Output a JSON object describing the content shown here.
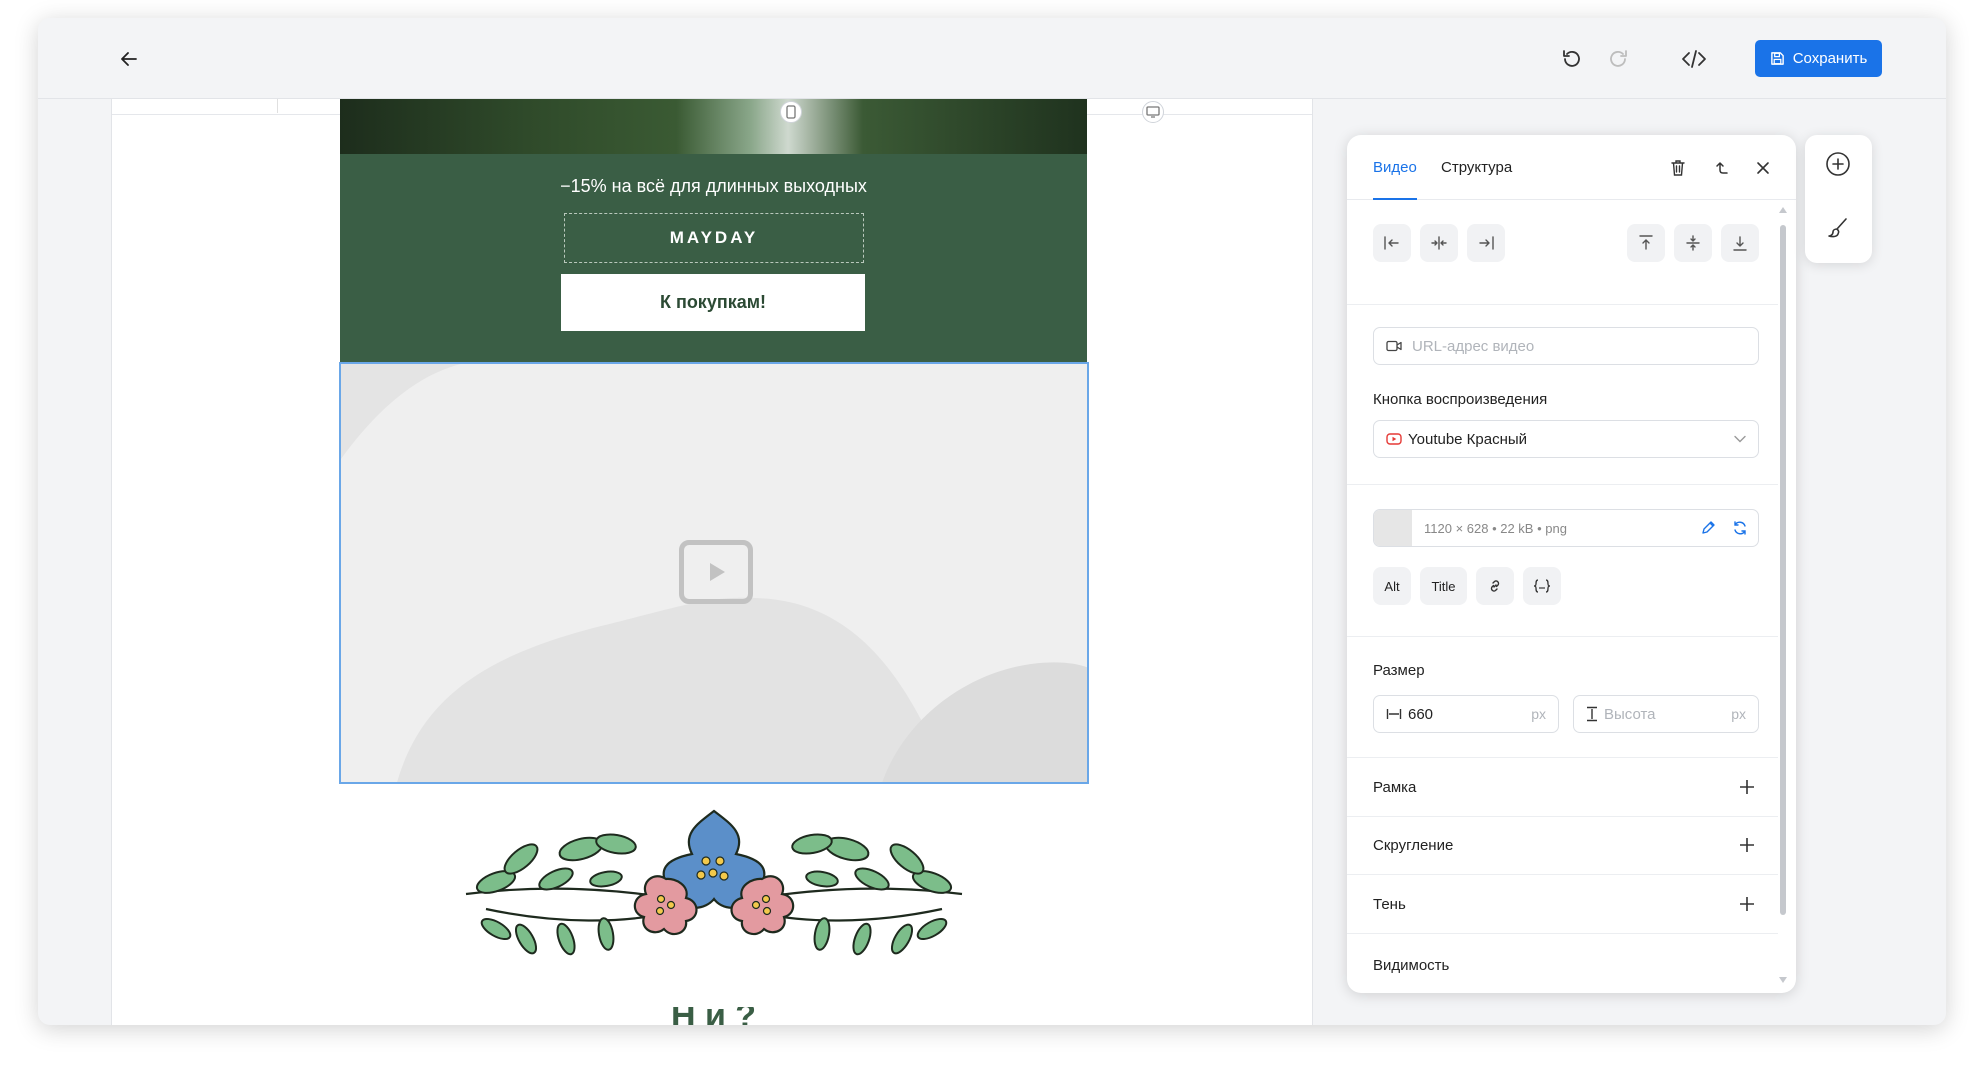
{
  "topbar": {
    "back_icon": "arrow-left-icon",
    "undo_icon": "undo-icon",
    "redo_icon": "redo-icon",
    "code_icon": "code-icon",
    "save_label": "Сохранить",
    "save_icon": "floppy-disk-icon",
    "colors": {
      "accent": "#1a73e8"
    }
  },
  "email": {
    "promo_text": "−15% на всё для длинных выходных",
    "coupon_code": "MAYDAY",
    "shop_button": "К покупкам!",
    "promo_bg": "#3a5e45",
    "video_placeholder_icon": "play-icon",
    "heading_partial": "Н                                  й     ?"
  },
  "panel": {
    "tabs": [
      {
        "label": "Видео",
        "active": true
      },
      {
        "label": "Структура",
        "active": false
      }
    ],
    "header_icons": [
      "trash-icon",
      "move-up-icon",
      "close-icon"
    ],
    "align_icons": [
      "align-left-icon",
      "align-center-h-icon",
      "align-right-icon",
      "align-top-icon",
      "align-middle-icon",
      "align-bottom-icon"
    ],
    "video_url_placeholder": "URL-адрес видео",
    "play_button_label": "Кнопка воспроизведения",
    "play_button_value": "Youtube Красный",
    "image_info": "1120 × 628  •  22 kB  •  png",
    "image_chips": [
      "Alt",
      "Title"
    ],
    "image_chip_icons": [
      "link-icon",
      "variable-icon"
    ],
    "size_label": "Размер",
    "width_value": "660",
    "width_unit": "px",
    "height_placeholder": "Высота",
    "height_unit": "px",
    "collapsible": [
      "Рамка",
      "Скругление",
      "Тень"
    ],
    "visibility_label": "Видимость"
  },
  "toolbox": {
    "icons": [
      "add-icon",
      "brush-icon"
    ]
  }
}
